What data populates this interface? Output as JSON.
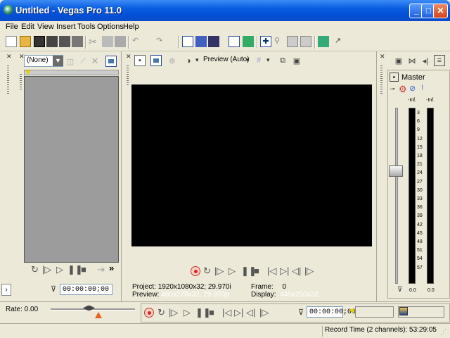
{
  "window": {
    "title": "Untitled - Vegas Pro 11.0"
  },
  "menu": [
    "File",
    "Edit",
    "View",
    "Insert",
    "Tools",
    "Options",
    "Help"
  ],
  "trimmer": {
    "source_select": "(None)",
    "timecode": "00:00:00;00"
  },
  "preview": {
    "quality_label": "Preview (Auto)",
    "project_label": "Project:",
    "project_value": "1920x1080x32; 29.970i",
    "preview_label": "Preview:",
    "preview_value": "480x270x32; 29.970p",
    "frame_label": "Frame:",
    "frame_value": "0",
    "display_label": "Display:",
    "display_value": "445x250x32"
  },
  "mixer": {
    "master_label": "Master",
    "peak_left": "-Inf.",
    "peak_right": "-Inf.",
    "scale": [
      "3",
      "6",
      "9",
      "12",
      "15",
      "18",
      "21",
      "24",
      "27",
      "30",
      "33",
      "36",
      "39",
      "42",
      "45",
      "48",
      "51",
      "54",
      "57"
    ],
    "fader_left": "0.0",
    "fader_right": "0.0"
  },
  "transport": {
    "rate_label": "Rate: 0.00",
    "timecode": "00:00:00;00"
  },
  "status": {
    "record_time": "Record Time (2 channels): 53:29:05"
  }
}
